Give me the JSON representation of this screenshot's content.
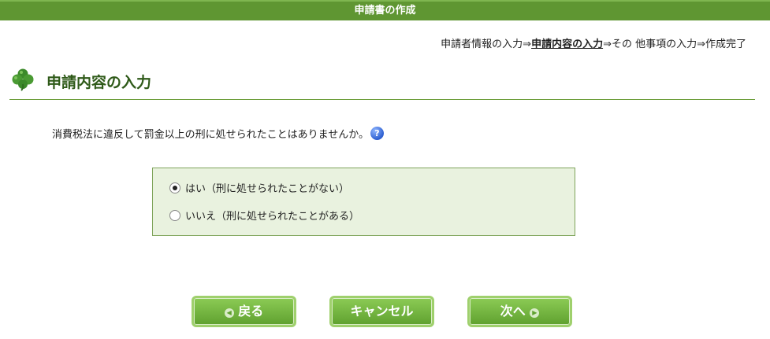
{
  "window": {
    "title": "申請書の作成"
  },
  "breadcrumb": {
    "step1": "申請者情報の入力⇒",
    "step2": "申請内容の入力",
    "step3": "⇒その 他事項の入力⇒作成完了"
  },
  "section": {
    "heading": "申請内容の入力",
    "icon": "clover-icon"
  },
  "question": {
    "text": "消費税法に違反して罰金以上の刑に処せられたことはありませんか。",
    "help_symbol": "?"
  },
  "options": [
    {
      "label": "はい（刑に処せられたことがない）",
      "selected": true
    },
    {
      "label": "いいえ（刑に処せられたことがある）",
      "selected": false
    }
  ],
  "buttons": {
    "back": "戻る",
    "cancel": "キャンセル",
    "next": "次へ"
  },
  "colors": {
    "header_green": "#5f9632",
    "button_green": "#6fb23c",
    "panel_bg": "#e9f2df"
  }
}
